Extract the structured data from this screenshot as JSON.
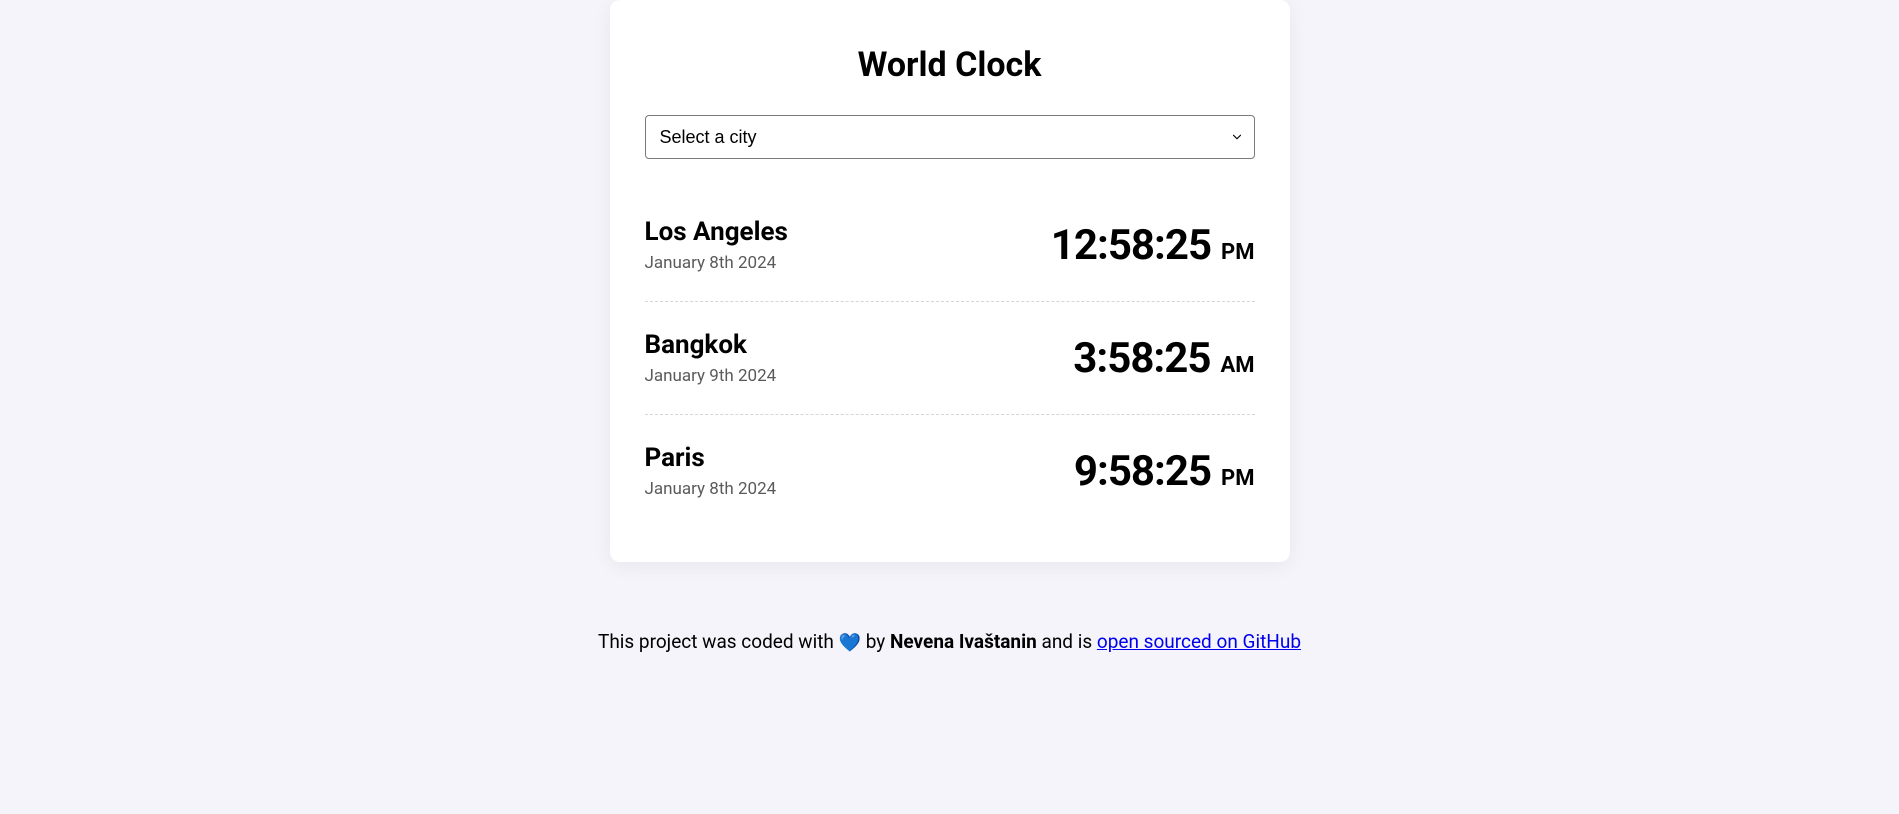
{
  "title": "World Clock",
  "select": {
    "placeholder": "Select a city"
  },
  "cities": [
    {
      "name": "Los Angeles",
      "date": "January 8th 2024",
      "time": "12:58:25",
      "ampm": "PM"
    },
    {
      "name": "Bangkok",
      "date": "January 9th 2024",
      "time": "3:58:25",
      "ampm": "AM"
    },
    {
      "name": "Paris",
      "date": "January 8th 2024",
      "time": "9:58:25",
      "ampm": "PM"
    }
  ],
  "footer": {
    "prefix": "This project was coded with ",
    "heart": "💙",
    "by": " by ",
    "author": "Nevena Ivaštanin",
    "middle": " and is ",
    "link": "open sourced on GitHub"
  }
}
